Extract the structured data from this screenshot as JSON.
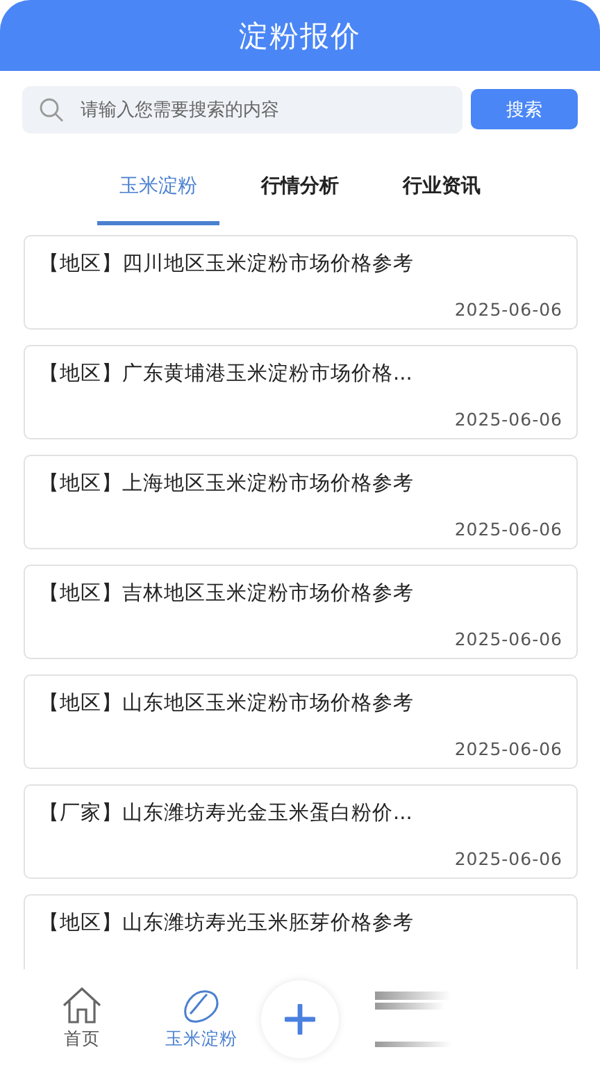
{
  "header": {
    "title": "淀粉报价"
  },
  "search": {
    "placeholder": "请输入您需要搜索的内容",
    "button": "搜索"
  },
  "tabs": [
    {
      "label": "玉米淀粉",
      "selected": true
    },
    {
      "label": "行情分析",
      "selected": false
    },
    {
      "label": "行业资讯",
      "selected": false
    }
  ],
  "articles": [
    {
      "title": "【地区】四川地区玉米淀粉市场价格参考",
      "date": "2025-06-06"
    },
    {
      "title": "【地区】广东黄埔港玉米淀粉市场价格...",
      "date": "2025-06-06"
    },
    {
      "title": "【地区】上海地区玉米淀粉市场价格参考",
      "date": "2025-06-06"
    },
    {
      "title": "【地区】吉林地区玉米淀粉市场价格参考",
      "date": "2025-06-06"
    },
    {
      "title": "【地区】山东地区玉米淀粉市场价格参考",
      "date": "2025-06-06"
    },
    {
      "title": "【厂家】山东潍坊寿光金玉米蛋白粉价...",
      "date": "2025-06-06"
    },
    {
      "title": "【地区】山东潍坊寿光玉米胚芽价格参考"
    }
  ],
  "bottom_nav": [
    {
      "kind": "home",
      "label": "首页",
      "selected": false
    },
    {
      "kind": "corn",
      "label": "玉米淀粉",
      "selected": true
    },
    {
      "kind": "add"
    },
    {
      "kind": "blurred"
    }
  ]
}
